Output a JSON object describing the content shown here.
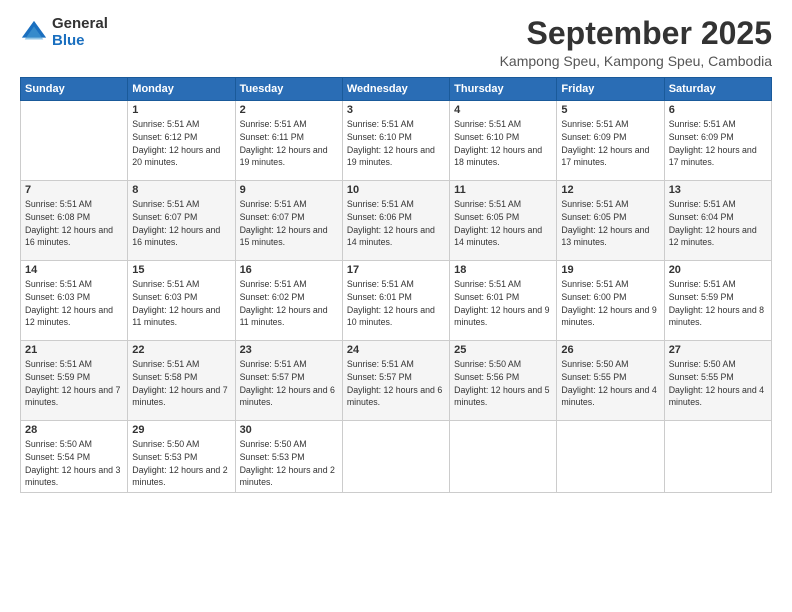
{
  "logo": {
    "general": "General",
    "blue": "Blue"
  },
  "header": {
    "title": "September 2025",
    "subtitle": "Kampong Speu, Kampong Speu, Cambodia"
  },
  "weekdays": [
    "Sunday",
    "Monday",
    "Tuesday",
    "Wednesday",
    "Thursday",
    "Friday",
    "Saturday"
  ],
  "weeks": [
    [
      {
        "day": "",
        "sunrise": "",
        "sunset": "",
        "daylight": ""
      },
      {
        "day": "1",
        "sunrise": "Sunrise: 5:51 AM",
        "sunset": "Sunset: 6:12 PM",
        "daylight": "Daylight: 12 hours and 20 minutes."
      },
      {
        "day": "2",
        "sunrise": "Sunrise: 5:51 AM",
        "sunset": "Sunset: 6:11 PM",
        "daylight": "Daylight: 12 hours and 19 minutes."
      },
      {
        "day": "3",
        "sunrise": "Sunrise: 5:51 AM",
        "sunset": "Sunset: 6:10 PM",
        "daylight": "Daylight: 12 hours and 19 minutes."
      },
      {
        "day": "4",
        "sunrise": "Sunrise: 5:51 AM",
        "sunset": "Sunset: 6:10 PM",
        "daylight": "Daylight: 12 hours and 18 minutes."
      },
      {
        "day": "5",
        "sunrise": "Sunrise: 5:51 AM",
        "sunset": "Sunset: 6:09 PM",
        "daylight": "Daylight: 12 hours and 17 minutes."
      },
      {
        "day": "6",
        "sunrise": "Sunrise: 5:51 AM",
        "sunset": "Sunset: 6:09 PM",
        "daylight": "Daylight: 12 hours and 17 minutes."
      }
    ],
    [
      {
        "day": "7",
        "sunrise": "Sunrise: 5:51 AM",
        "sunset": "Sunset: 6:08 PM",
        "daylight": "Daylight: 12 hours and 16 minutes."
      },
      {
        "day": "8",
        "sunrise": "Sunrise: 5:51 AM",
        "sunset": "Sunset: 6:07 PM",
        "daylight": "Daylight: 12 hours and 16 minutes."
      },
      {
        "day": "9",
        "sunrise": "Sunrise: 5:51 AM",
        "sunset": "Sunset: 6:07 PM",
        "daylight": "Daylight: 12 hours and 15 minutes."
      },
      {
        "day": "10",
        "sunrise": "Sunrise: 5:51 AM",
        "sunset": "Sunset: 6:06 PM",
        "daylight": "Daylight: 12 hours and 14 minutes."
      },
      {
        "day": "11",
        "sunrise": "Sunrise: 5:51 AM",
        "sunset": "Sunset: 6:05 PM",
        "daylight": "Daylight: 12 hours and 14 minutes."
      },
      {
        "day": "12",
        "sunrise": "Sunrise: 5:51 AM",
        "sunset": "Sunset: 6:05 PM",
        "daylight": "Daylight: 12 hours and 13 minutes."
      },
      {
        "day": "13",
        "sunrise": "Sunrise: 5:51 AM",
        "sunset": "Sunset: 6:04 PM",
        "daylight": "Daylight: 12 hours and 12 minutes."
      }
    ],
    [
      {
        "day": "14",
        "sunrise": "Sunrise: 5:51 AM",
        "sunset": "Sunset: 6:03 PM",
        "daylight": "Daylight: 12 hours and 12 minutes."
      },
      {
        "day": "15",
        "sunrise": "Sunrise: 5:51 AM",
        "sunset": "Sunset: 6:03 PM",
        "daylight": "Daylight: 12 hours and 11 minutes."
      },
      {
        "day": "16",
        "sunrise": "Sunrise: 5:51 AM",
        "sunset": "Sunset: 6:02 PM",
        "daylight": "Daylight: 12 hours and 11 minutes."
      },
      {
        "day": "17",
        "sunrise": "Sunrise: 5:51 AM",
        "sunset": "Sunset: 6:01 PM",
        "daylight": "Daylight: 12 hours and 10 minutes."
      },
      {
        "day": "18",
        "sunrise": "Sunrise: 5:51 AM",
        "sunset": "Sunset: 6:01 PM",
        "daylight": "Daylight: 12 hours and 9 minutes."
      },
      {
        "day": "19",
        "sunrise": "Sunrise: 5:51 AM",
        "sunset": "Sunset: 6:00 PM",
        "daylight": "Daylight: 12 hours and 9 minutes."
      },
      {
        "day": "20",
        "sunrise": "Sunrise: 5:51 AM",
        "sunset": "Sunset: 5:59 PM",
        "daylight": "Daylight: 12 hours and 8 minutes."
      }
    ],
    [
      {
        "day": "21",
        "sunrise": "Sunrise: 5:51 AM",
        "sunset": "Sunset: 5:59 PM",
        "daylight": "Daylight: 12 hours and 7 minutes."
      },
      {
        "day": "22",
        "sunrise": "Sunrise: 5:51 AM",
        "sunset": "Sunset: 5:58 PM",
        "daylight": "Daylight: 12 hours and 7 minutes."
      },
      {
        "day": "23",
        "sunrise": "Sunrise: 5:51 AM",
        "sunset": "Sunset: 5:57 PM",
        "daylight": "Daylight: 12 hours and 6 minutes."
      },
      {
        "day": "24",
        "sunrise": "Sunrise: 5:51 AM",
        "sunset": "Sunset: 5:57 PM",
        "daylight": "Daylight: 12 hours and 6 minutes."
      },
      {
        "day": "25",
        "sunrise": "Sunrise: 5:50 AM",
        "sunset": "Sunset: 5:56 PM",
        "daylight": "Daylight: 12 hours and 5 minutes."
      },
      {
        "day": "26",
        "sunrise": "Sunrise: 5:50 AM",
        "sunset": "Sunset: 5:55 PM",
        "daylight": "Daylight: 12 hours and 4 minutes."
      },
      {
        "day": "27",
        "sunrise": "Sunrise: 5:50 AM",
        "sunset": "Sunset: 5:55 PM",
        "daylight": "Daylight: 12 hours and 4 minutes."
      }
    ],
    [
      {
        "day": "28",
        "sunrise": "Sunrise: 5:50 AM",
        "sunset": "Sunset: 5:54 PM",
        "daylight": "Daylight: 12 hours and 3 minutes."
      },
      {
        "day": "29",
        "sunrise": "Sunrise: 5:50 AM",
        "sunset": "Sunset: 5:53 PM",
        "daylight": "Daylight: 12 hours and 2 minutes."
      },
      {
        "day": "30",
        "sunrise": "Sunrise: 5:50 AM",
        "sunset": "Sunset: 5:53 PM",
        "daylight": "Daylight: 12 hours and 2 minutes."
      },
      {
        "day": "",
        "sunrise": "",
        "sunset": "",
        "daylight": ""
      },
      {
        "day": "",
        "sunrise": "",
        "sunset": "",
        "daylight": ""
      },
      {
        "day": "",
        "sunrise": "",
        "sunset": "",
        "daylight": ""
      },
      {
        "day": "",
        "sunrise": "",
        "sunset": "",
        "daylight": ""
      }
    ]
  ]
}
